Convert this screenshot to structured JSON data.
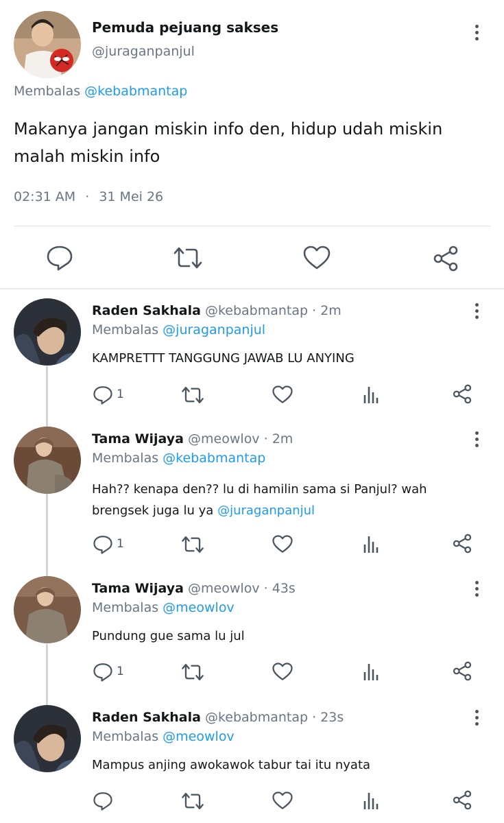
{
  "main_tweet": {
    "display_name": "Pemuda pejuang sakses",
    "handle": "@juraganpanjul",
    "replying_prefix": "Membalas",
    "replying_to": "@kebabmantap",
    "text": "Makanya jangan miskin info den, hidup udah miskin malah miskin info",
    "time": "02:31 AM",
    "separator": "·",
    "date": "31 Mei 26"
  },
  "replies": [
    {
      "display_name": "Raden Sakhala",
      "handle": "@kebabmantap",
      "time": "· 2m",
      "replying_prefix": "Membalas",
      "replying_to": "@juraganpanjul",
      "text": "KAMPRETTT TANGGUNG JAWAB LU ANYING",
      "mention": "",
      "reply_count": "1"
    },
    {
      "display_name": "Tama Wijaya",
      "handle": "@meowlov",
      "time": "· 2m",
      "replying_prefix": "Membalas",
      "replying_to": "@kebabmantap",
      "text_line1": "Hah?? kenapa den?? lu di hamilin sama si Panjul? wah",
      "text_line2": "brengsek juga lu ya",
      "mention": "@juraganpanjul",
      "reply_count": "1"
    },
    {
      "display_name": "Tama Wijaya",
      "handle": "@meowlov",
      "time": "· 43s",
      "replying_prefix": "Membalas",
      "replying_to": "@meowlov",
      "text": "Pundung gue sama lu jul",
      "reply_count": "1"
    },
    {
      "display_name": "Raden Sakhala",
      "handle": "@kebabmantap",
      "time": "· 23s",
      "replying_prefix": "Membalas",
      "replying_to": "@meowlov",
      "text": "Mampus anjing awokawok tabur tai itu nyata",
      "reply_count": ""
    }
  ],
  "icons": {
    "reply": "reply-icon",
    "retweet": "retweet-icon",
    "like": "like-icon",
    "share": "share-icon",
    "analytics": "analytics-icon",
    "more": "more-vertical-icon"
  },
  "colors": {
    "link": "#1d9bf0",
    "secondary_text": "#687684",
    "icon": "#4a5560"
  }
}
